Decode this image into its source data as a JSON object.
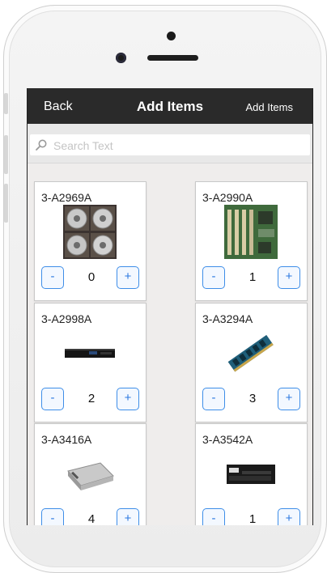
{
  "nav": {
    "back_label": "Back",
    "title": "Add Items",
    "add_label": "Add Items"
  },
  "search": {
    "placeholder": "Search Text",
    "value": ""
  },
  "controls": {
    "minus": "-",
    "plus": "+"
  },
  "items": [
    {
      "code": "3-A2969A",
      "qty": "0"
    },
    {
      "code": "3-A2990A",
      "qty": "1"
    },
    {
      "code": "3-A2998A",
      "qty": "2"
    },
    {
      "code": "3-A3294A",
      "qty": "3"
    },
    {
      "code": "3-A3416A",
      "qty": "4"
    },
    {
      "code": "3-A3542A",
      "qty": "1"
    }
  ],
  "colors": {
    "navbar": "#2a2a2a",
    "accent": "#2a78e0",
    "background": "#efedec"
  }
}
